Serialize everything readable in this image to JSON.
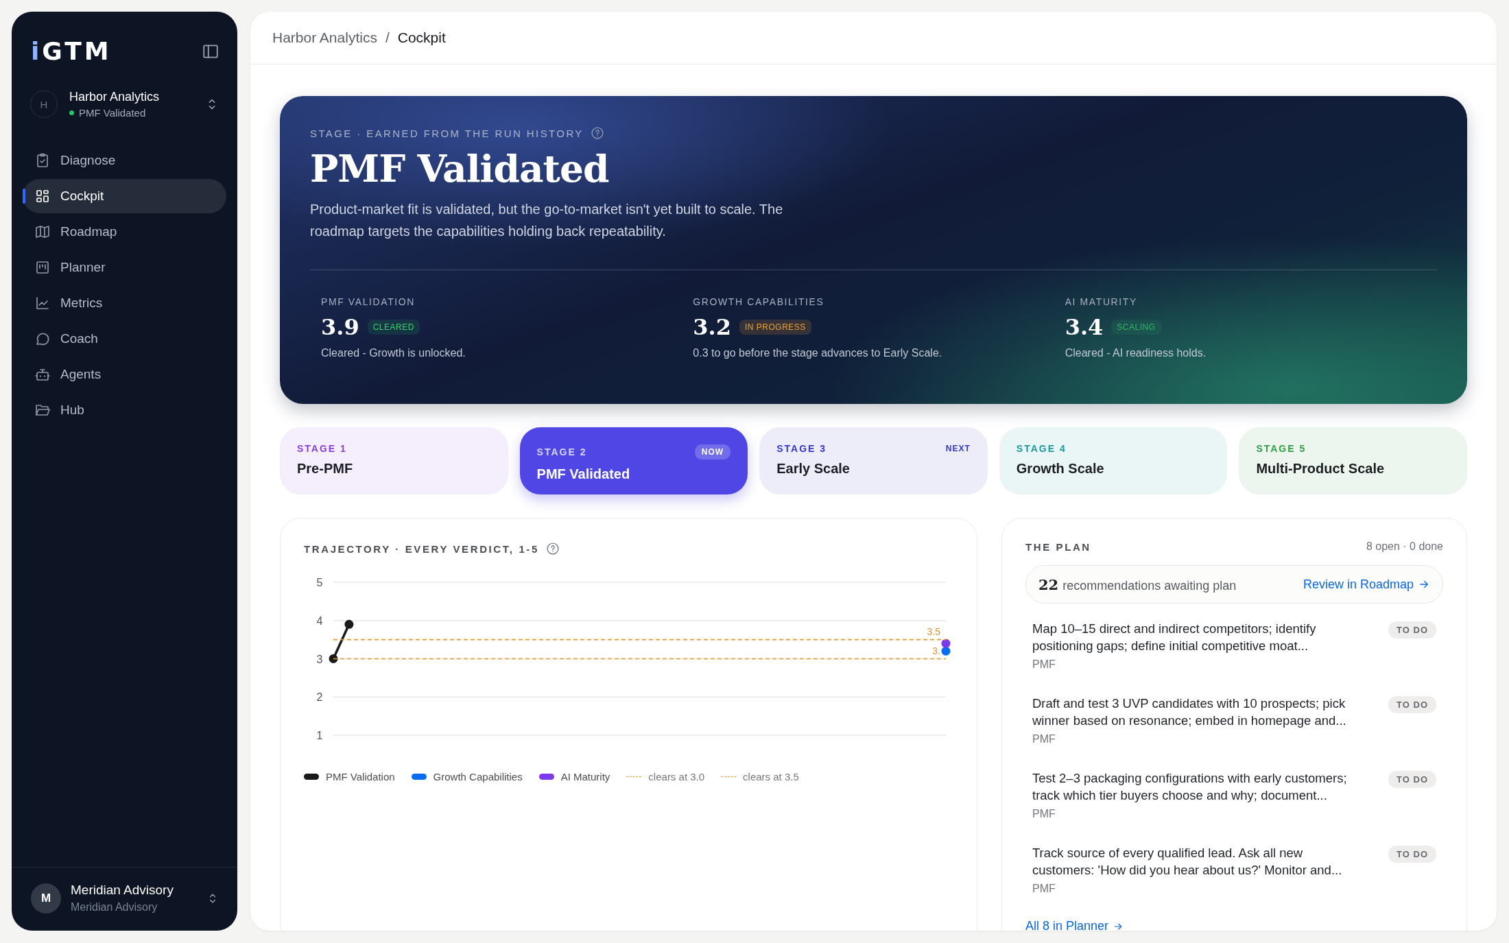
{
  "sidebar": {
    "logo": "iGTM",
    "workspace": {
      "initial": "H",
      "name": "Harbor Analytics",
      "status": "PMF Validated"
    },
    "items": [
      {
        "label": "Diagnose",
        "selected": false
      },
      {
        "label": "Cockpit",
        "selected": true
      },
      {
        "label": "Roadmap",
        "selected": false
      },
      {
        "label": "Planner",
        "selected": false
      },
      {
        "label": "Metrics",
        "selected": false
      },
      {
        "label": "Coach",
        "selected": false
      },
      {
        "label": "Agents",
        "selected": false
      },
      {
        "label": "Hub",
        "selected": false
      }
    ],
    "account": {
      "initial": "M",
      "name": "Meridian Advisory",
      "org": "Meridian Advisory"
    }
  },
  "breadcrumb": {
    "items": [
      "Harbor Analytics",
      "Cockpit"
    ],
    "separator": "/"
  },
  "hero": {
    "eyebrow": "STAGE · EARNED FROM THE RUN HISTORY",
    "title": "PMF Validated",
    "description": "Product-market fit is validated, but the go-to-market isn't yet built to scale. The roadmap targets the capabilities holding back repeatability.",
    "metrics": [
      {
        "label": "PMF VALIDATION",
        "score": "3.9",
        "badge": "CLEARED",
        "kind": "cleared",
        "note": "Cleared - Growth is unlocked."
      },
      {
        "label": "GROWTH CAPABILITIES",
        "score": "3.2",
        "badge": "IN PROGRESS",
        "kind": "in_progress",
        "note": "0.3 to go before the stage advances to Early Scale."
      },
      {
        "label": "AI MATURITY",
        "score": "3.4",
        "badge": "SCALING",
        "kind": "scaling",
        "note": "Cleared - AI readiness holds."
      }
    ]
  },
  "stages": [
    {
      "label": "STAGE 1",
      "name": "Pre-PMF",
      "color": "#8b3fd9",
      "selected": false
    },
    {
      "label": "STAGE 2",
      "name": "PMF Validated",
      "tag": "NOW",
      "color": "#4f46e5",
      "selected": true
    },
    {
      "label": "STAGE 3",
      "name": "Early Scale",
      "tag": "NEXT",
      "color": "#3538c9",
      "selected": false
    },
    {
      "label": "STAGE 4",
      "name": "Growth Scale",
      "color": "#1a9aa0",
      "selected": false
    },
    {
      "label": "STAGE 5",
      "name": "Multi-Product Scale",
      "color": "#2f9e44",
      "selected": false
    }
  ],
  "trajectory": {
    "title": "TRAJECTORY · EVERY VERDICT, 1-5",
    "chart_data": {
      "type": "line",
      "grid": true,
      "ylim": [
        1,
        5
      ],
      "yticks": [
        1,
        2,
        3,
        4,
        5
      ],
      "series": [
        {
          "name": "PMF Validation",
          "color": "#1a1a1a",
          "marker": "o",
          "values": [
            3.0,
            3.9,
            null,
            null,
            null,
            null,
            null,
            null,
            null,
            null,
            null,
            null,
            null,
            null,
            null,
            null,
            null,
            null,
            null,
            null,
            null,
            null,
            null,
            null,
            null,
            null,
            null,
            null,
            null,
            null,
            null,
            null,
            null,
            null,
            null,
            null,
            null,
            null,
            null,
            null
          ]
        },
        {
          "name": "Growth Capabilities",
          "color": "#0a6cf0",
          "marker": "o",
          "values": [
            null,
            null,
            null,
            null,
            null,
            null,
            null,
            null,
            null,
            null,
            null,
            null,
            null,
            null,
            null,
            null,
            null,
            null,
            null,
            null,
            null,
            null,
            null,
            null,
            null,
            null,
            null,
            null,
            null,
            null,
            null,
            null,
            null,
            null,
            null,
            null,
            null,
            null,
            null,
            3.2
          ]
        },
        {
          "name": "AI Maturity",
          "color": "#7c3aed",
          "marker": "o",
          "values": [
            null,
            null,
            null,
            null,
            null,
            null,
            null,
            null,
            null,
            null,
            null,
            null,
            null,
            null,
            null,
            null,
            null,
            null,
            null,
            null,
            null,
            null,
            null,
            null,
            null,
            null,
            null,
            null,
            null,
            null,
            null,
            null,
            null,
            null,
            null,
            null,
            null,
            null,
            null,
            3.4
          ]
        },
        {
          "name": "clears at 3.0",
          "color": "#e39a2e",
          "line_style": "dashed",
          "values": [
            3.0,
            3.0,
            3.0,
            3.0,
            3.0,
            3.0,
            3.0,
            3.0,
            3.0,
            3.0,
            3.0,
            3.0,
            3.0,
            3.0,
            3.0,
            3.0,
            3.0,
            3.0,
            3.0,
            3.0,
            3.0,
            3.0,
            3.0,
            3.0,
            3.0,
            3.0,
            3.0,
            3.0,
            3.0,
            3.0,
            3.0,
            3.0,
            3.0,
            3.0,
            3.0,
            3.0,
            3.0,
            3.0,
            3.0,
            3.0
          ]
        },
        {
          "name": "clears at 3.5",
          "color": "#e39a2e",
          "line_style": "dashed",
          "values": [
            3.5,
            3.5,
            3.5,
            3.5,
            3.5,
            3.5,
            3.5,
            3.5,
            3.5,
            3.5,
            3.5,
            3.5,
            3.5,
            3.5,
            3.5,
            3.5,
            3.5,
            3.5,
            3.5,
            3.5,
            3.5,
            3.5,
            3.5,
            3.5,
            3.5,
            3.5,
            3.5,
            3.5,
            3.5,
            3.5,
            3.5,
            3.5,
            3.5,
            3.5,
            3.5,
            3.5,
            3.5,
            3.5,
            3.5,
            3.5
          ]
        }
      ],
      "annotations": [
        "3.5",
        "3."
      ]
    }
  },
  "plan": {
    "title": "THE PLAN",
    "summary": "8 open · 0 done",
    "banner": {
      "count": "22",
      "text": "recommendations awaiting plan",
      "link": "Review in Roadmap"
    },
    "tasks": [
      {
        "text": "Map 10–15 direct and indirect competitors; identify positioning gaps; define initial competitive moat...",
        "tag": "PMF",
        "status": "TO DO"
      },
      {
        "text": "Draft and test 3 UVP candidates with 10 prospects; pick winner based on resonance; embed in homepage and...",
        "tag": "PMF",
        "status": "TO DO"
      },
      {
        "text": "Test 2–3 packaging configurations with early customers; track which tier buyers choose and why; document...",
        "tag": "PMF",
        "status": "TO DO"
      },
      {
        "text": "Track source of every qualified lead. Ask all new customers: 'How did you hear about us?' Monitor and...",
        "tag": "PMF",
        "status": "TO DO"
      }
    ],
    "footer_link": "All 8 in Planner"
  }
}
